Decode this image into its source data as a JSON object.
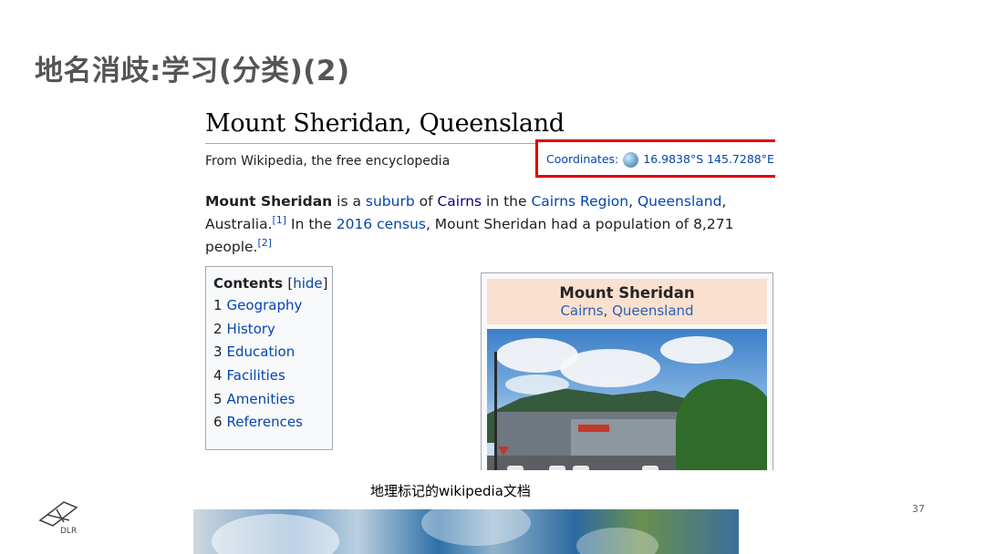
{
  "slide": {
    "title": "地名消歧:学习(分类)(2)",
    "caption": "地理标记的wikipedia文档",
    "page_number": "37",
    "logo_text": "DLR"
  },
  "article": {
    "title": "Mount Sheridan, Queensland",
    "tagline": "From Wikipedia, the free encyclopedia",
    "coordinates": {
      "label": "Coordinates:",
      "icon": "globe-icon",
      "value": "16.9838°S 145.7288°E",
      "highlight_color": "#e00000"
    },
    "intro": {
      "subject": "Mount Sheridan",
      "t1": " is a ",
      "suburb": "suburb",
      "t2": " of ",
      "cairns": "Cairns",
      "t3": " in the ",
      "region": "Cairns Region",
      "t4": ", ",
      "queensland": "Queensland",
      "t5": ",",
      "australia": "Australia.",
      "ref1": "[1]",
      "t6": " In the ",
      "census": "2016 census",
      "t7": ", Mount Sheridan had a population of 8,271",
      "people": "people.",
      "ref2": "[2]"
    },
    "toc": {
      "heading": "Contents",
      "hide_open": "[",
      "hide_label": "hide",
      "hide_close": "]",
      "items": [
        {
          "num": "1",
          "label": "Geography"
        },
        {
          "num": "2",
          "label": "History"
        },
        {
          "num": "3",
          "label": "Education"
        },
        {
          "num": "4",
          "label": "Facilities"
        },
        {
          "num": "5",
          "label": "Amenities"
        },
        {
          "num": "6",
          "label": "References"
        }
      ]
    },
    "infobox": {
      "title": "Mount Sheridan",
      "subtitle_link1": "Cairns",
      "subtitle_sep": ", ",
      "subtitle_link2": "Queensland",
      "header_color": "#fbdcc8"
    }
  },
  "colors": {
    "link": "#0645ad",
    "title": "#555555"
  }
}
